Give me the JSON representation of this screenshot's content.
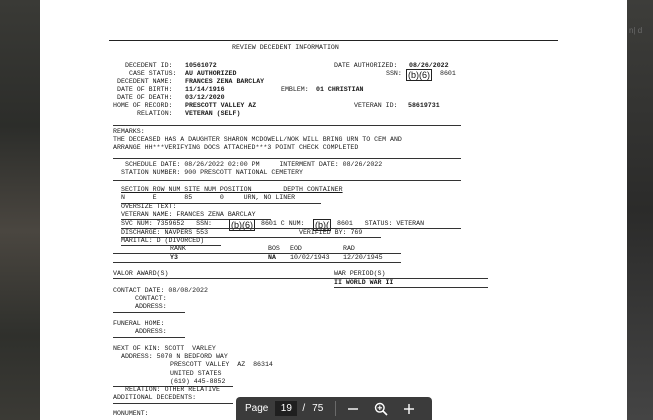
{
  "document": {
    "header": "REVIEW DECEDENT INFORMATION",
    "decedent_id_label": "DECEDENT ID:",
    "decedent_id": "10561072",
    "date_authorized_label": "DATE AUTHORIZED:",
    "date_authorized": "08/26/2022",
    "case_status_label": "CASE STATUS:",
    "case_status": "AU AUTHORIZED",
    "ssn_label": "SSN:",
    "redaction": "(b)(6)",
    "redaction_short": "(b)(",
    "ssn_suffix": "8601",
    "decedent_name_label": "DECEDENT NAME:",
    "decedent_name": "FRANCES ZENA BARCLAY",
    "dob_label": "DATE OF BIRTH:",
    "dob": "11/14/1916",
    "emblem_label": "EMBLEM:",
    "emblem": "01 CHRISTIAN",
    "dod_label": "DATE OF DEATH:",
    "dod": "03/12/2020",
    "home_label": "HOME OF RECORD:",
    "home": "PRESCOTT VALLEY AZ",
    "veteran_id_label": "VETERAN ID:",
    "veteran_id": "58619731",
    "relation_label": "RELATION:",
    "relation": "VETERAN (SELF)",
    "remarks_label": "REMARKS:",
    "remarks_1": "THE DECEASED HAS A DAUGHTER SHARON MCDOWELL/NOK WILL BRING URN TO CEM AND",
    "remarks_2": "ARRANGE HH***VERIFYING DOCS ATTACHED***3 POINT CHECK COMPLETED",
    "schedule_line": "SCHEDULE DATE: 08/26/2022 02:00 PM     INTERMENT DATE: 08/26/2022",
    "station_line": "STATION NUMBER: 900 PRESCOTT NATIONAL CEMETERY",
    "grid_header": "SECTION ROW NUM SITE NUM POSITION        DEPTH CONTAINER",
    "grid_values": "N       E       85       0     URN, NO LINER",
    "oversize": "OVERSIZE TEXT:",
    "veteran_name_line": "VETERAN NAME: FRANCES ZENA BARCLAY",
    "svc_num_line": "SVC NUM: 7359652   SSN:",
    "c_num_line": "8601 C NUM:",
    "status_line": "8601   STATUS: VETERAN",
    "discharge_line": "DISCHARGE: NAVPERS 553",
    "verified_line": "VERIFIED BY: 769",
    "marital_line": "MARITAL: D (DIVORCED)",
    "rank_header": "RANK",
    "bos_header": "BOS",
    "eod_header": "EOD",
    "rad_header": "RAD",
    "rank": "Y3",
    "bos": "NA",
    "eod": "10/02/1943",
    "rad": "12/20/1945",
    "valor_label": "VALOR AWARD(S)",
    "war_label": "WAR PERIOD(S)",
    "war_value": "II WORLD WAR II",
    "contact_date_line": "CONTACT DATE: 08/08/2022",
    "contact_label": "CONTACT:",
    "address_label": "ADDRESS:",
    "funeral_label": "FUNERAL HOME:",
    "nok_line": "NEXT OF KIN: SCOTT  VARLEY",
    "nok_addr_1": "ADDRESS: 5070 N BEDFORD WAY",
    "nok_addr_2": "PRESCOTT VALLEY  AZ  86314",
    "nok_addr_3": "UNITED STATES",
    "nok_phone": "(619) 445-8852",
    "nok_relation": "RELATION: OTHER RELATIVE",
    "additional_line": "ADDITIONAL DECEDENTS:",
    "monument_line": "MONUMENT:"
  },
  "toolbar": {
    "page_label": "Page",
    "current_page": "19",
    "separator": "/",
    "total_pages": "75"
  },
  "background": {
    "ghost_text": "n|  d"
  }
}
